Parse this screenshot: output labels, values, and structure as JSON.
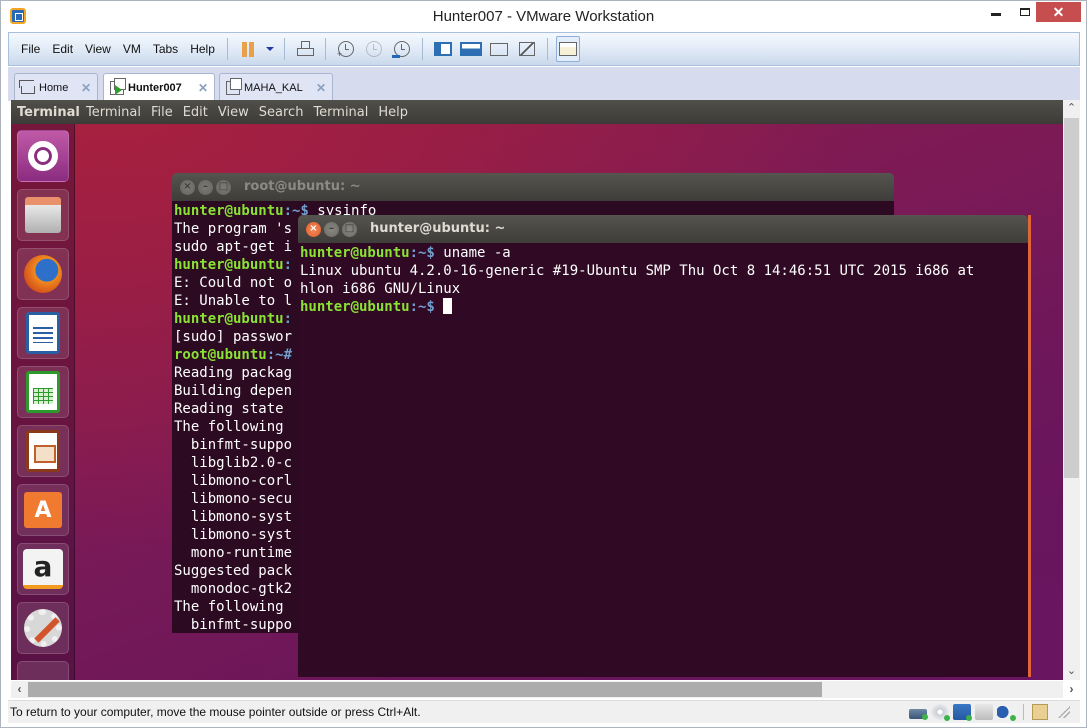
{
  "window": {
    "title": "Hunter007 - VMware Workstation",
    "controls": {
      "minimize": "minimize",
      "maximize": "maximize",
      "close": "✕"
    }
  },
  "menubar": {
    "items": [
      "File",
      "Edit",
      "View",
      "VM",
      "Tabs",
      "Help"
    ]
  },
  "toolbar": {
    "icons": [
      "pause-icon",
      "power-dropdown-icon",
      "send-ctrl-alt-del-icon",
      "take-snapshot-icon",
      "revert-snapshot-icon",
      "snapshot-manager-icon",
      "show-library-icon",
      "show-thumbnail-bar-icon",
      "full-screen-icon",
      "unity-icon",
      "console-view-icon"
    ]
  },
  "tabs": [
    {
      "label": "Home",
      "icon": "home-icon",
      "active": false,
      "close": "✕"
    },
    {
      "label": "Hunter007",
      "icon": "vm-running-icon",
      "active": true,
      "close": "✕"
    },
    {
      "label": "MAHA_KAL",
      "icon": "vm-icon",
      "active": false,
      "close": "✕"
    }
  ],
  "guest": {
    "topbar": {
      "app_name": "Terminal",
      "menus": [
        "Terminal",
        "File",
        "Edit",
        "View",
        "Search",
        "Terminal",
        "Help"
      ]
    },
    "launcher": [
      {
        "name": "ubuntu-dash"
      },
      {
        "name": "files"
      },
      {
        "name": "firefox"
      },
      {
        "name": "libreoffice-writer"
      },
      {
        "name": "libreoffice-calc"
      },
      {
        "name": "libreoffice-impress"
      },
      {
        "name": "ubuntu-software-center",
        "glyph": "A"
      },
      {
        "name": "amazon",
        "glyph": "a"
      },
      {
        "name": "system-settings"
      },
      {
        "name": "unknown-app"
      }
    ],
    "back_terminal": {
      "title": "root@ubuntu: ~",
      "lines": [
        {
          "user": "hunter@ubuntu",
          "path": ":~$",
          "text": " sysinfo"
        },
        {
          "text": "The program 's"
        },
        {
          "text": "sudo apt-get i"
        },
        {
          "user": "hunter@ubuntu",
          "path": ":",
          "text": ""
        },
        {
          "text": "E: Could not o"
        },
        {
          "text": "E: Unable to l"
        },
        {
          "user": "hunter@ubuntu",
          "path": ":",
          "text": ""
        },
        {
          "text": "[sudo] passwor"
        },
        {
          "user": "root@ubuntu",
          "path": ":~#",
          "text": ""
        },
        {
          "text": "Reading packag"
        },
        {
          "text": "Building depen"
        },
        {
          "text": "Reading state "
        },
        {
          "text": "The following "
        },
        {
          "text": "  binfmt-suppo"
        },
        {
          "text": "  libglib2.0-c"
        },
        {
          "text": "  libmono-corl"
        },
        {
          "text": "  libmono-secu"
        },
        {
          "text": "  libmono-syst"
        },
        {
          "text": "  libmono-syst"
        },
        {
          "text": "  mono-runtime"
        },
        {
          "text": "Suggested pack"
        },
        {
          "text": "  monodoc-gtk2"
        },
        {
          "text": "The following "
        },
        {
          "text": "  binfmt-suppo"
        }
      ]
    },
    "front_terminal": {
      "title": "hunter@ubuntu: ~",
      "lines": [
        {
          "user": "hunter@ubuntu",
          "path": ":~$",
          "text": " uname -a"
        },
        {
          "text": "Linux ubuntu 4.2.0-16-generic #19-Ubuntu SMP Thu Oct 8 14:46:51 UTC 2015 i686 at"
        },
        {
          "text": "hlon i686 GNU/Linux"
        },
        {
          "user": "hunter@ubuntu",
          "path": ":~$",
          "text": " ",
          "cursor": true
        }
      ]
    }
  },
  "scrollbars": {
    "vertical": {
      "up": "⌃",
      "down": "⌄"
    },
    "horizontal": {
      "left": "‹",
      "right": "›"
    }
  },
  "statusbar": {
    "message": "To return to your computer, move the mouse pointer outside or press Ctrl+Alt.",
    "devices": [
      "hard-disk",
      "cd-dvd",
      "network-adapter",
      "printer",
      "sound-card"
    ]
  }
}
